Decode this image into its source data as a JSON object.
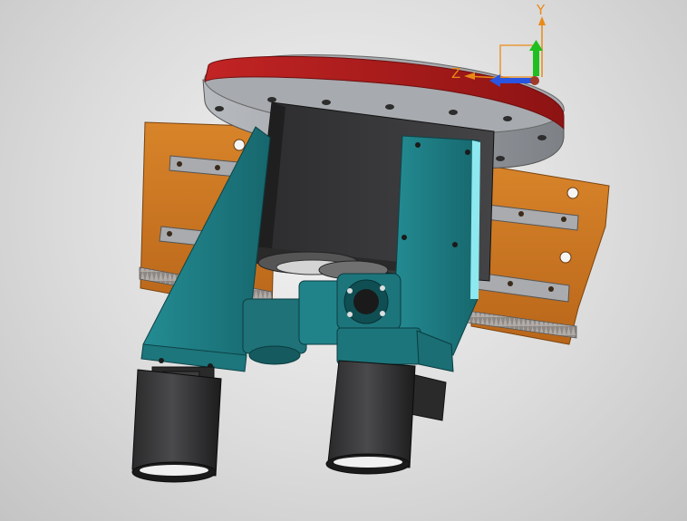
{
  "viewport": {
    "background_top": "#f4f4f4",
    "background_bottom": "#c4c4c4"
  },
  "triad": {
    "y_label": "Y",
    "z_label": "Z",
    "y_color": "#e98a17",
    "z_color": "#e98a17",
    "y_arrow_color": "#1fbf1f",
    "x_arrow_color": "#2a55e0",
    "origin_color": "#a03a2a"
  },
  "model": {
    "turntable_top_color": "#b31d1d",
    "turntable_body_color": "#9a9ea3",
    "plate_color": "#cf7a22",
    "frame_color": "#1f7f86",
    "motor_color": "#3a3a3c",
    "rail_color": "#a8aaad",
    "rack_color": "#9b9693"
  }
}
